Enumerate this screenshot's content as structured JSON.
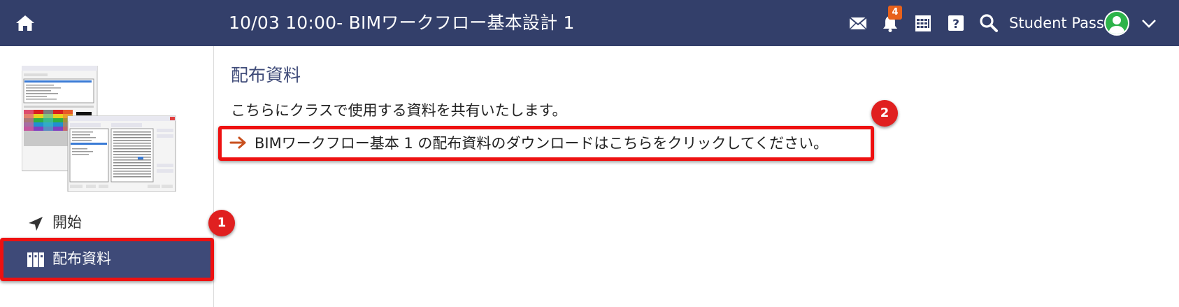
{
  "header": {
    "title": "10/03 10:00- BIMワークフロー基本設計 1",
    "notification_count": "4",
    "user_name": "Student Pass",
    "icons": [
      "home-icon",
      "mail-icon",
      "bell-icon",
      "calendar-icon",
      "help-icon",
      "search-icon",
      "user-avatar-icon",
      "chevron-down-icon"
    ],
    "bg_color": "#333f6a"
  },
  "sidebar": {
    "items": [
      {
        "label": "開始",
        "icon": "navigation-arrow-icon",
        "active": false
      },
      {
        "label": "配布資料",
        "icon": "books-icon",
        "active": true
      }
    ],
    "active_color": "#3e4a78"
  },
  "main": {
    "section_title": "配布資料",
    "description": "こちらにクラスで使用する資料を共有いたします。",
    "download_link": "BIMワークフロー基本 1 の配布資料のダウンロードはこちらをクリックしてください。",
    "link_arrow_color": "#c8501e"
  },
  "annotations": {
    "callout_1": "1",
    "callout_2": "2",
    "highlight_color": "#ee1111"
  }
}
